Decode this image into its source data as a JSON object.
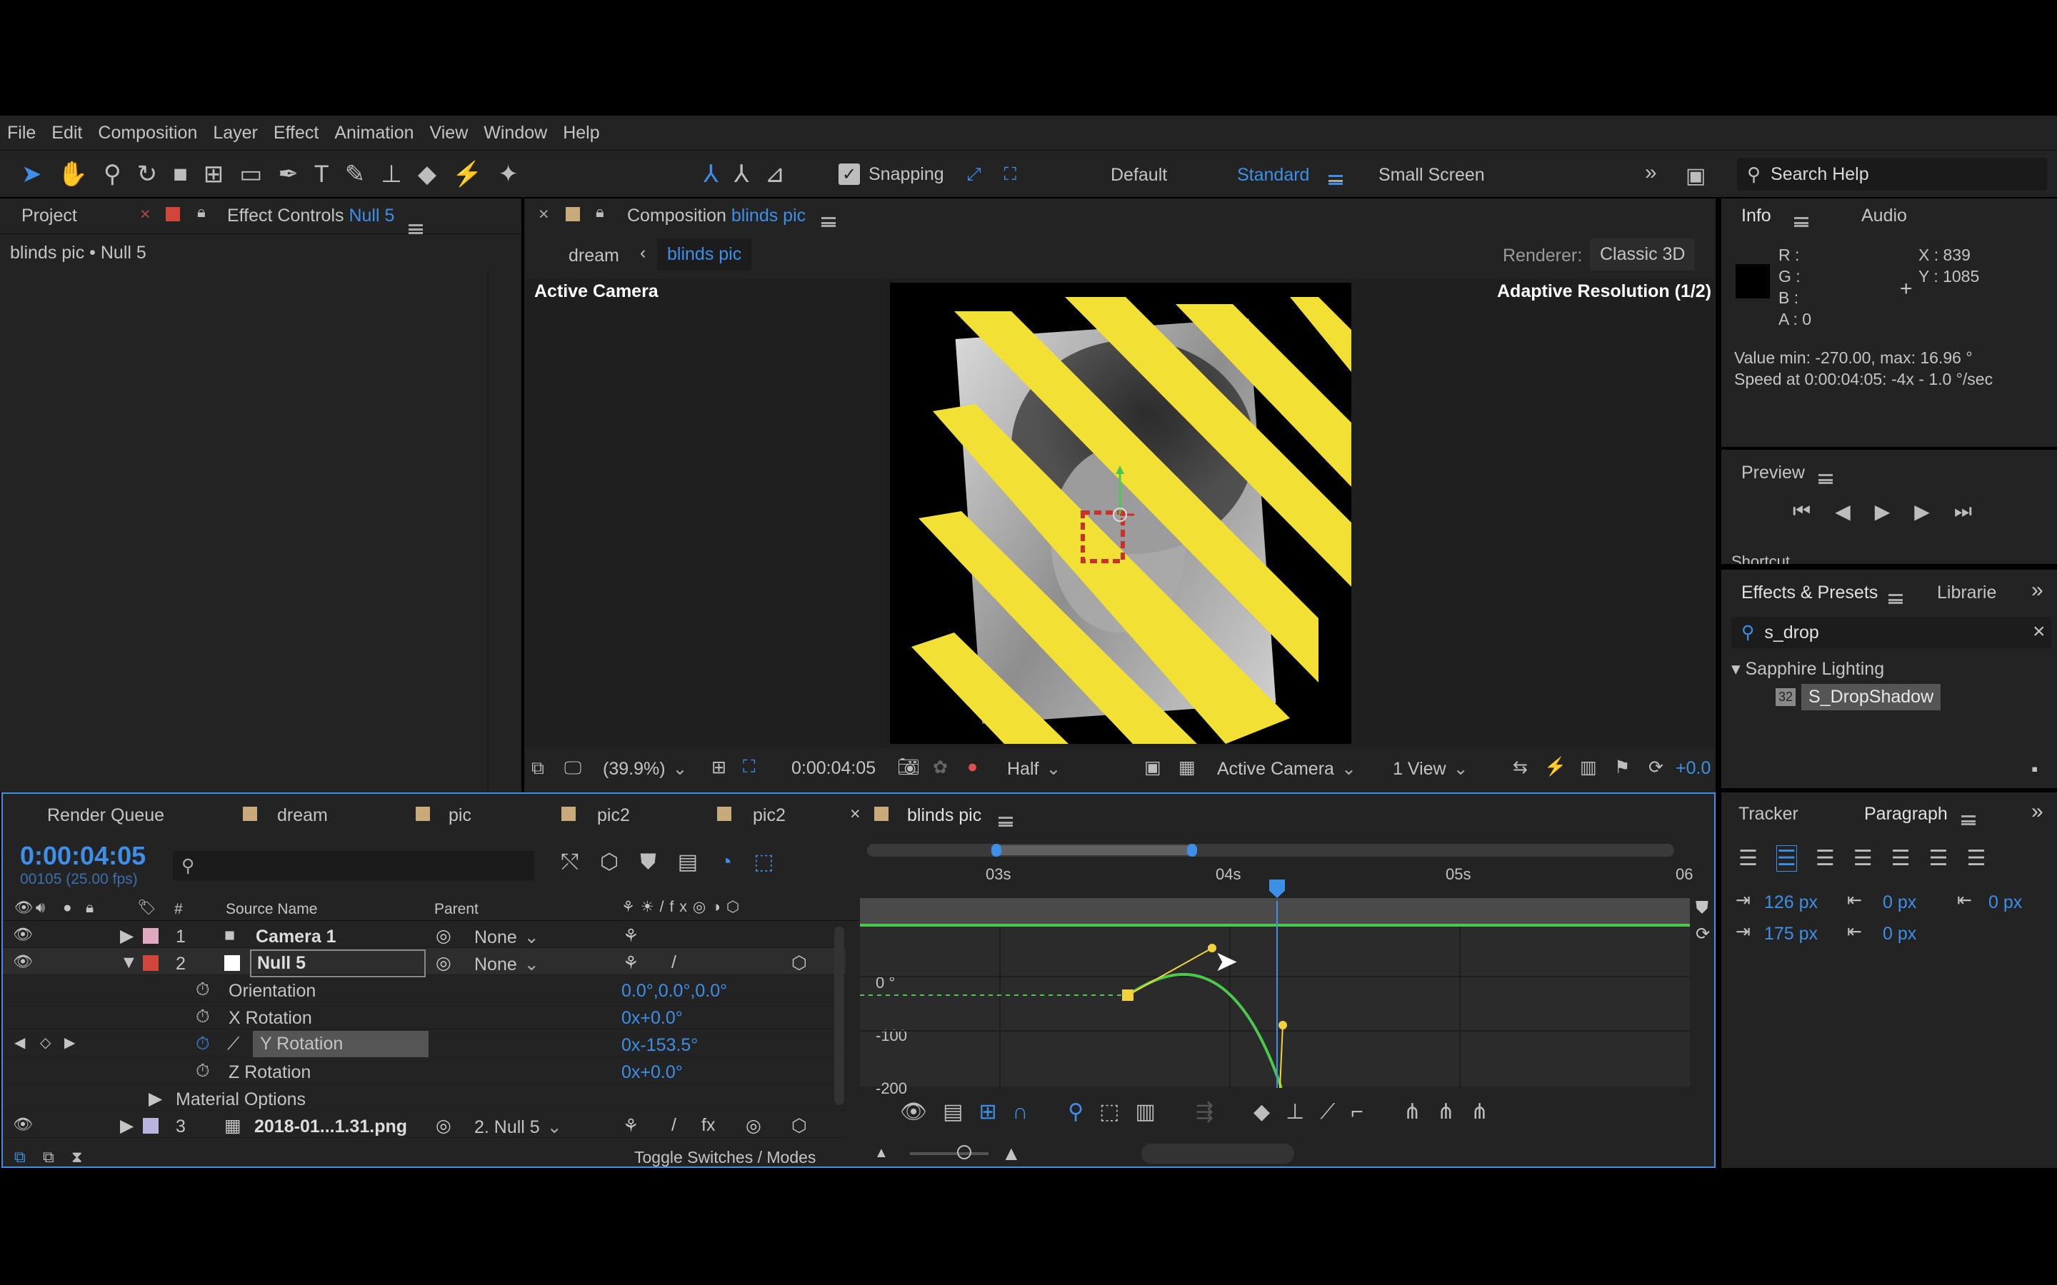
{
  "menu": [
    "File",
    "Edit",
    "Composition",
    "Layer",
    "Effect",
    "Animation",
    "View",
    "Window",
    "Help"
  ],
  "toolbar": {
    "snapping": "Snapping",
    "workspaces": [
      "Default",
      "Standard",
      "Small Screen"
    ],
    "search_placeholder": "Search Help"
  },
  "left_panel": {
    "tab_project": "Project",
    "tab_effect_controls": "Effect Controls",
    "effect_controls_target": "Null 5",
    "breadcrumb": "blinds pic • Null 5"
  },
  "comp_panel": {
    "tab_prefix": "Composition",
    "comp_name": "blinds pic",
    "breadcrumb_parent": "dream",
    "breadcrumb_current": "blinds pic",
    "renderer_label": "Renderer:",
    "renderer_value": "Classic 3D",
    "active_camera": "Active Camera",
    "adaptive_resolution": "Adaptive Resolution (1/2)"
  },
  "viewer_bar": {
    "zoom": "(39.9%)",
    "timecode": "0:00:04:05",
    "resolution": "Half",
    "camera": "Active Camera",
    "views": "1 View",
    "exposure": "+0.0"
  },
  "info_panel": {
    "tab_info": "Info",
    "tab_audio": "Audio",
    "r": "R :",
    "g": "G :",
    "b": "B :",
    "a": "A : 0",
    "x": "X : 839",
    "y": "Y : 1085",
    "value_line": "Value min: -270.00, max: 16.96 °",
    "speed_line": "Speed at 0:00:04:05: -4x - 1.0 °/sec"
  },
  "preview_panel": {
    "title": "Preview",
    "shortcut": "Shortcut"
  },
  "effects_panel": {
    "tab_effects": "Effects & Presets",
    "tab_libraries": "Librarie",
    "search_value": "s_drop",
    "category": "Sapphire Lighting",
    "item": "S_DropShadow",
    "item_badge": "32"
  },
  "timeline": {
    "tabs": [
      {
        "label": "Render Queue",
        "color": ""
      },
      {
        "label": "dream",
        "color": "#c8a97a"
      },
      {
        "label": "pic",
        "color": "#c8a97a"
      },
      {
        "label": "pic2",
        "color": "#c8a97a"
      },
      {
        "label": "pic2",
        "color": "#c8a97a"
      },
      {
        "label": "blinds pic",
        "color": "#c8a97a"
      }
    ],
    "timecode": "0:00:04:05",
    "fps": "00105 (25.00 fps)",
    "col_num": "#",
    "col_source": "Source Name",
    "col_parent": "Parent",
    "layers": [
      {
        "num": "1",
        "name": "Camera 1",
        "parent": "None",
        "color": "#e0a9c0"
      },
      {
        "num": "2",
        "name": "Null 5",
        "parent": "None",
        "color": "#d0463a"
      },
      {
        "num": "3",
        "name": "2018-01...1.31.png",
        "parent": "2. Null 5",
        "color": "#b8b4e0"
      }
    ],
    "properties": [
      {
        "name": "Orientation",
        "value": "0.0°,0.0°,0.0°"
      },
      {
        "name": "X Rotation",
        "value": "0x+0.0°"
      },
      {
        "name": "Y Rotation",
        "value": "0x-153.5°"
      },
      {
        "name": "Z Rotation",
        "value": "0x+0.0°"
      }
    ],
    "material_options": "Material Options",
    "toggle_modes": "Toggle Switches / Modes",
    "ruler": [
      "03s",
      "04s",
      "05s",
      "06"
    ],
    "graph_labels": [
      "0 °",
      "-100",
      "-200"
    ]
  },
  "paragraph_panel": {
    "tab_tracker": "Tracker",
    "tab_paragraph": "Paragraph",
    "indent_left": "126 px",
    "indent_right": "0 px",
    "space_before": "0 px",
    "first_line": "175 px",
    "space_after": "0 px"
  },
  "colors": {
    "accent": "#3d8fe8",
    "graph_curve": "#4cc94c",
    "keyframe": "#f2d23c",
    "playhead": "#3d8fe8",
    "stripe": "#f2e035"
  }
}
